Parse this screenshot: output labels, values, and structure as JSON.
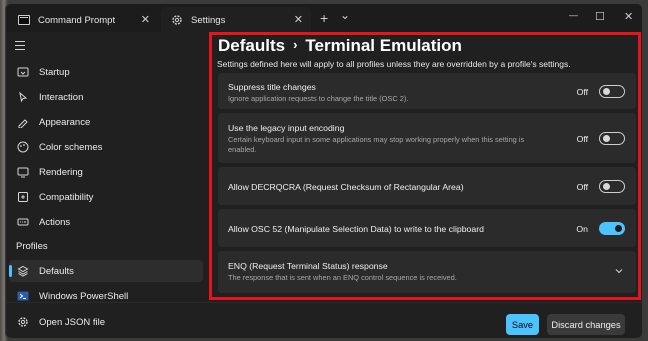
{
  "titlebar": {
    "tabs": [
      {
        "label": "Command Prompt",
        "icon": "command-prompt-icon"
      },
      {
        "label": "Settings",
        "icon": "gear-icon"
      }
    ],
    "new_tab": "+",
    "dropdown": "⌄",
    "tab_close": "✕",
    "minimize": "—",
    "maximize": "☐",
    "close": "✕"
  },
  "sidebar": {
    "items": [
      {
        "label": "Startup",
        "icon": "startup-icon"
      },
      {
        "label": "Interaction",
        "icon": "interaction-icon"
      },
      {
        "label": "Appearance",
        "icon": "appearance-icon"
      },
      {
        "label": "Color schemes",
        "icon": "color-schemes-icon"
      },
      {
        "label": "Rendering",
        "icon": "rendering-icon"
      },
      {
        "label": "Compatibility",
        "icon": "compatibility-icon"
      },
      {
        "label": "Actions",
        "icon": "actions-icon"
      }
    ],
    "profiles_header": "Profiles",
    "profiles": [
      {
        "label": "Defaults",
        "icon": "layers-icon",
        "selected": true
      },
      {
        "label": "Windows PowerShell",
        "icon": "powershell-icon",
        "selected": false
      }
    ],
    "open_json": "Open JSON file"
  },
  "main": {
    "breadcrumb_parent": "Defaults",
    "breadcrumb_separator": "›",
    "breadcrumb_current": "Terminal Emulation",
    "subtitle": "Settings defined here will apply to all profiles unless they are overridden by a profile's settings.",
    "settings": [
      {
        "title": "Suppress title changes",
        "description": "Ignore application requests to change the title (OSC 2).",
        "state": "Off"
      },
      {
        "title": "Use the legacy input encoding",
        "description": "Certain keyboard input in some applications may stop working properly when this setting is enabled.",
        "state": "Off"
      },
      {
        "title": "Allow DECRQCRA (Request Checksum of Rectangular Area)",
        "description": "",
        "state": "Off"
      },
      {
        "title": "Allow OSC 52 (Manipulate Selection Data) to write to the clipboard",
        "description": "",
        "state": "On"
      },
      {
        "title": "ENQ (Request Terminal Status) response",
        "description": "The response that is sent when an ENQ control sequence is received.",
        "state": ""
      }
    ]
  },
  "footer": {
    "save_label": "Save",
    "discard_label": "Discard changes"
  },
  "colors": {
    "accent": "#4cc2ff",
    "highlight": "#e8141c"
  }
}
